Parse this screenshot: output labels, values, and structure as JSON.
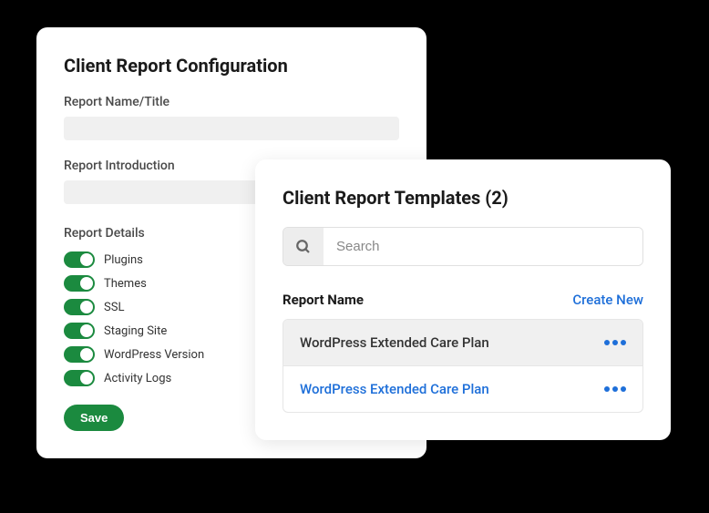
{
  "config": {
    "title": "Client Report Configuration",
    "name_label": "Report Name/Title",
    "name_value": "",
    "intro_label": "Report Introduction",
    "intro_value": "",
    "details_label": "Report Details",
    "toggles": [
      {
        "label": "Plugins",
        "on": true
      },
      {
        "label": "Themes",
        "on": true
      },
      {
        "label": "SSL",
        "on": true
      },
      {
        "label": "Staging Site",
        "on": true
      },
      {
        "label": "WordPress Version",
        "on": true
      },
      {
        "label": "Activity Logs",
        "on": true
      }
    ],
    "save_label": "Save"
  },
  "templates": {
    "title": "Client Report Templates (2)",
    "search_placeholder": "Search",
    "header_label": "Report Name",
    "create_label": "Create New",
    "rows": [
      {
        "name": "WordPress Extended Care Plan",
        "selected": true
      },
      {
        "name": "WordPress Extended Care Plan",
        "selected": false
      }
    ]
  }
}
